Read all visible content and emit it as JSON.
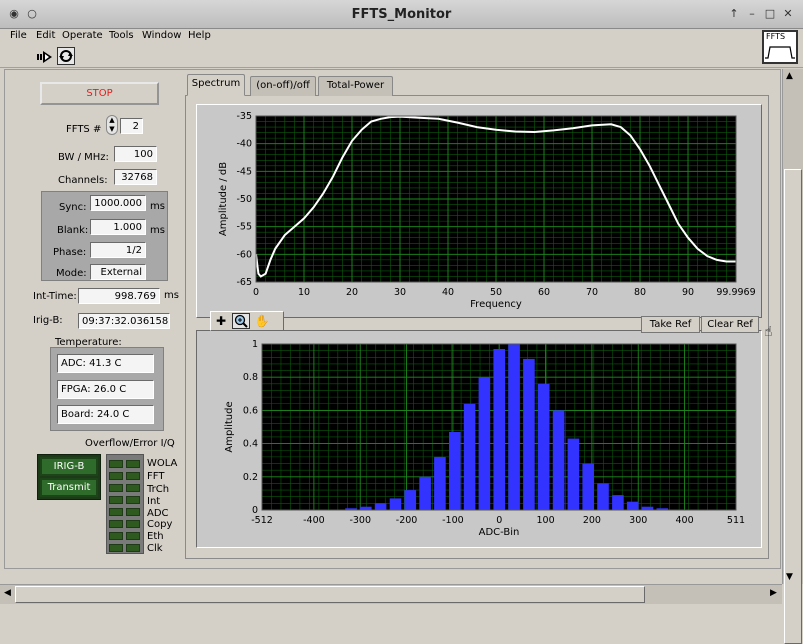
{
  "window": {
    "title": "FFTS_Monitor"
  },
  "menu": [
    "File",
    "Edit",
    "Operate",
    "Tools",
    "Window",
    "Help"
  ],
  "ffts_icon_label": "FFTS",
  "controls": {
    "stop_label": "STOP",
    "ffts_label": "FFTS #",
    "ffts_value": "2",
    "bw_label": "BW / MHz:",
    "bw_value": "100",
    "channels_label": "Channels:",
    "channels_value": "32768",
    "sync_label": "Sync:",
    "sync_value": "1000.000",
    "sync_unit": "ms",
    "blank_label": "Blank:",
    "blank_value": "1.000",
    "blank_unit": "ms",
    "phase_label": "Phase:",
    "phase_value": "1/2",
    "mode_label": "Mode:",
    "mode_value": "External",
    "inttime_label": "Int-Time:",
    "inttime_value": "998.769",
    "inttime_unit": "ms",
    "irigb_label": "Irig-B:",
    "irigb_value": "09:37:32.036158",
    "temperature_label": "Temperature:",
    "adc_temp": "ADC: 41.3 C",
    "fpga_temp": "FPGA: 26.0 C",
    "board_temp": "Board: 24.0 C",
    "overflow_label": "Overflow/Error I/Q",
    "irig_btn": "IRIG-B",
    "transmit_btn": "Transmit",
    "indicators": [
      "WOLA",
      "FFT",
      "TrCh",
      "Int",
      "ADC",
      "Copy",
      "Eth",
      "Clk"
    ]
  },
  "tabs": [
    "Spectrum",
    "(on-off)/off",
    "Total-Power"
  ],
  "active_tab": 0,
  "buttons": {
    "take_ref": "Take Ref",
    "clear_ref": "Clear Ref"
  },
  "chart_data": [
    {
      "type": "line",
      "title": "",
      "xlabel": "Frequency",
      "ylabel": "Amplitude / dB",
      "xlim": [
        0,
        99.9969
      ],
      "ylim": [
        -65,
        -35
      ],
      "xticks": [
        "0",
        "10",
        "20",
        "30",
        "40",
        "50",
        "60",
        "70",
        "80",
        "90",
        "99.9969"
      ],
      "yticks": [
        "-35",
        "-40",
        "-45",
        "-50",
        "-55",
        "-60",
        "-65"
      ],
      "grid": true,
      "color": "#ffffff",
      "x": [
        0,
        0.5,
        1,
        2,
        3,
        4,
        6,
        8,
        10,
        12,
        14,
        16,
        18,
        20,
        22,
        24,
        26,
        28,
        30,
        34,
        38,
        42,
        46,
        50,
        54,
        58,
        62,
        66,
        70,
        74,
        76,
        78,
        80,
        82,
        84,
        86,
        88,
        90,
        92,
        94,
        96,
        98,
        99.9969
      ],
      "y": [
        -60,
        -63.5,
        -64,
        -63.5,
        -61,
        -59,
        -56.5,
        -55,
        -53.5,
        -51.5,
        -49,
        -46,
        -42.5,
        -39.5,
        -37.5,
        -36,
        -35.5,
        -35.2,
        -35.1,
        -35.3,
        -35.5,
        -36.2,
        -37,
        -37.5,
        -37.8,
        -37.9,
        -37.6,
        -37.2,
        -36.7,
        -36.5,
        -37,
        -38.5,
        -41,
        -44,
        -47.5,
        -51,
        -54.5,
        -57,
        -59,
        -60.3,
        -61,
        -61.3,
        -61.3
      ]
    },
    {
      "type": "bar",
      "title": "",
      "xlabel": "ADC-Bin",
      "ylabel": "Amplitude",
      "xlim": [
        -512,
        511
      ],
      "ylim": [
        0,
        1
      ],
      "xticks": [
        "-512",
        "-400",
        "-300",
        "-200",
        "-100",
        "0",
        "100",
        "200",
        "300",
        "400",
        "511"
      ],
      "yticks": [
        "1",
        "0.8",
        "0.6",
        "0.4",
        "0.2",
        "0"
      ],
      "grid": true,
      "color": "#3333ff",
      "x": [
        -448,
        -416,
        -384,
        -352,
        -320,
        -288,
        -256,
        -224,
        -192,
        -160,
        -128,
        -96,
        -64,
        -32,
        0,
        32,
        64,
        96,
        128,
        160,
        192,
        224,
        256,
        288,
        320,
        352,
        384,
        416
      ],
      "values": [
        0.0,
        0.0,
        0.0,
        0.0,
        0.01,
        0.02,
        0.04,
        0.07,
        0.12,
        0.2,
        0.32,
        0.47,
        0.64,
        0.8,
        0.97,
        1.0,
        0.91,
        0.76,
        0.6,
        0.43,
        0.28,
        0.16,
        0.09,
        0.05,
        0.02,
        0.01,
        0.0,
        0.0
      ]
    }
  ]
}
